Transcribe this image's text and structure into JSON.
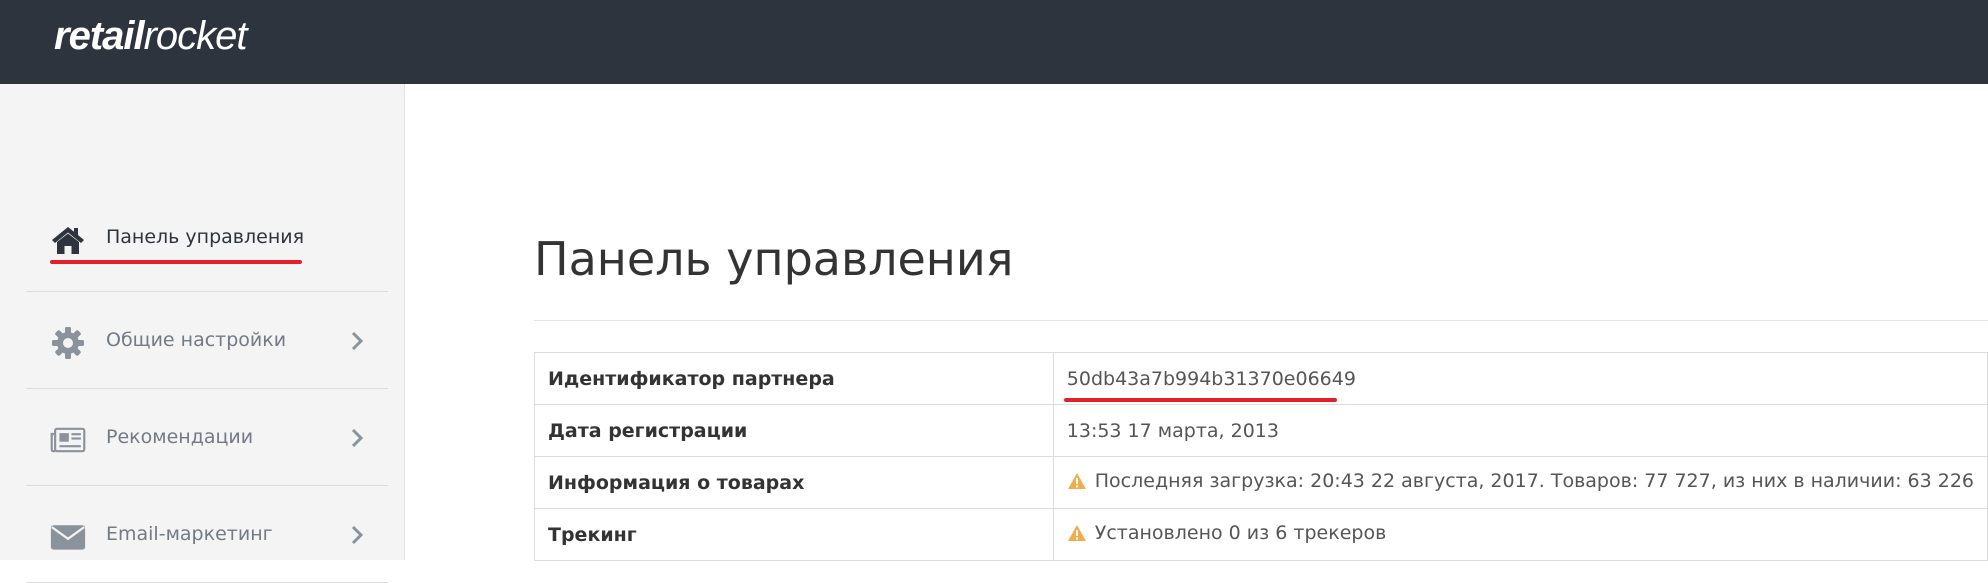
{
  "header": {
    "logo_bold": "retail",
    "logo_light": "rocket",
    "background_color": "#2d343d"
  },
  "sidebar": {
    "items": [
      {
        "label": "Панель управления",
        "icon": "home-icon",
        "active": true
      },
      {
        "label": "Общие настройки",
        "icon": "gear-icon",
        "active": false
      },
      {
        "label": "Рекомендации",
        "icon": "newspaper-icon",
        "active": false
      },
      {
        "label": "Email-маркетинг",
        "icon": "envelope-icon",
        "active": false
      }
    ]
  },
  "main": {
    "title": "Панель управления",
    "rows": [
      {
        "key": "Идентификатор партнера",
        "value": "50db43a7b994b31370e06649"
      },
      {
        "key": "Дата регистрации",
        "value": "13:53 17 марта, 2013"
      },
      {
        "key": "Информация о товарах",
        "value": "Последняя загрузка: 20:43 22 августа, 2017. Товаров: 77 727, из них в наличии: 63 226",
        "warning": true
      },
      {
        "key": "Трекинг",
        "value": "Установлено 0 из 6 трекеров",
        "warning": true
      }
    ]
  },
  "colors": {
    "accent_red": "#e3202a",
    "warning_yellow": "#f0ad4e",
    "sidebar_bg": "#f4f4f4"
  }
}
